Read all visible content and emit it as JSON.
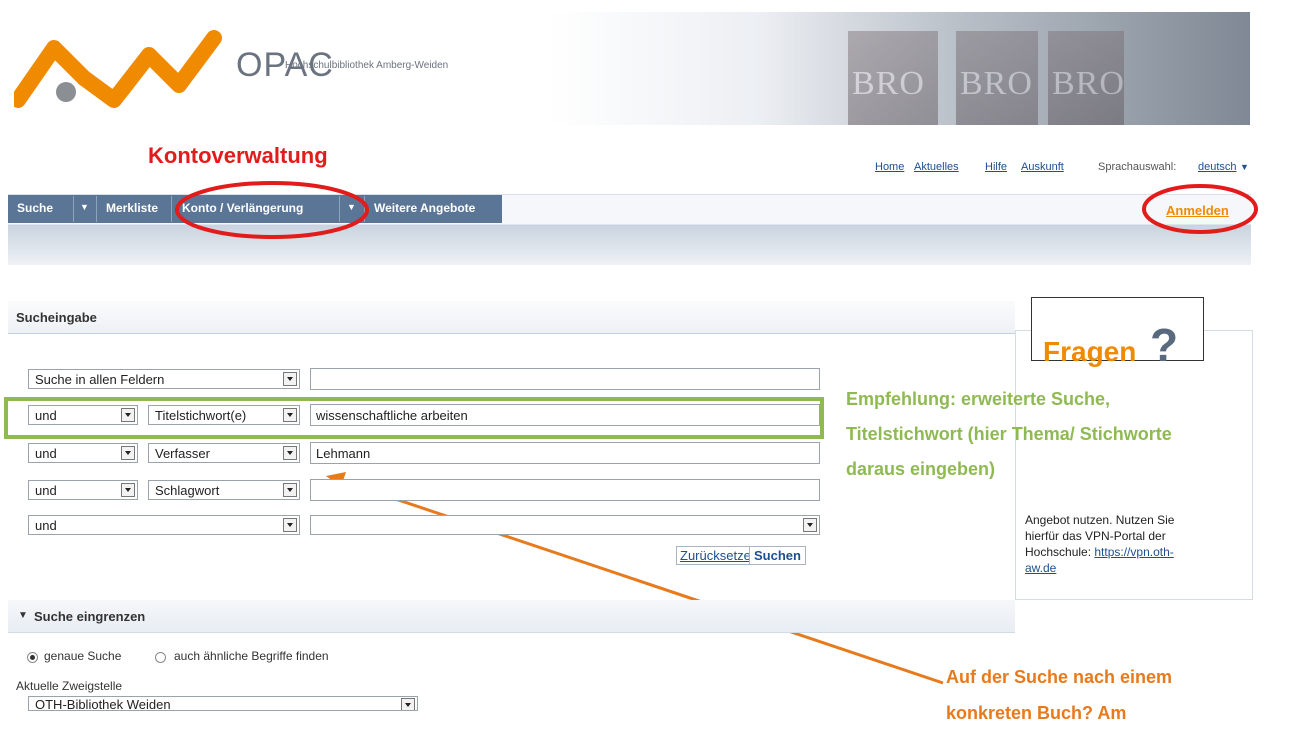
{
  "header": {
    "opac": "OPAC",
    "library_name": "Hochschulbibliothek Amberg-Weiden",
    "book_labels": [
      "BRO",
      "BRO",
      "BRO"
    ]
  },
  "top_links": [
    "Home",
    "Aktuelles",
    "Hilfe",
    "Auskunft"
  ],
  "language": {
    "label": "Sprachauswahl:",
    "value": "deutsch"
  },
  "nav": {
    "items": [
      "Suche",
      "Merkliste",
      "Konto / Verlängerung",
      "Weitere Angebote"
    ],
    "login": "Anmelden"
  },
  "search": {
    "title": "Sucheingabe",
    "first_field": "Suche in allen Feldern",
    "first_value": "",
    "rows": [
      {
        "op": "und",
        "field": "Titelstichwort(e)",
        "value": "wissenschaftliche arbeiten"
      },
      {
        "op": "und",
        "field": "Verfasser",
        "value": "Lehmann"
      },
      {
        "op": "und",
        "field": "Schlagwort",
        "value": ""
      },
      {
        "op": "und",
        "field": "",
        "value": ""
      }
    ],
    "reset": "Zurücksetzen",
    "submit": "Suchen"
  },
  "limit": {
    "title": "Suche eingrenzen",
    "radio_exact": "genaue Suche",
    "radio_similar": "auch ähnliche Begriffe finden",
    "branch_label": "Aktuelle Zweigstelle",
    "branch_value": "OTH-Bibliothek Weiden"
  },
  "sidebar": {
    "fragen": "Fragen",
    "question_mark": "?",
    "text_lines": [
      "Angebot nutzen. Nutzen Sie",
      "hierfür das VPN-Portal der",
      "Hochschule: "
    ],
    "vpn_link_1": "https://vpn.oth-",
    "vpn_link_2": "aw.de"
  },
  "annotations": {
    "konto": "Kontoverwaltung",
    "empfehlung": [
      "Empfehlung: erweiterte Suche,",
      "Titelstichwort (hier Thema/ Stichworte",
      "daraus eingeben)"
    ],
    "buch": [
      "Auf der Suche nach einem",
      "konkreten Buch? Am"
    ]
  },
  "colors": {
    "nav_blue": "#5b7596",
    "accent_orange": "#f08a00",
    "annot_red": "#e21b1b",
    "annot_green": "#8fba52",
    "annot_orange": "#e87a1c"
  }
}
